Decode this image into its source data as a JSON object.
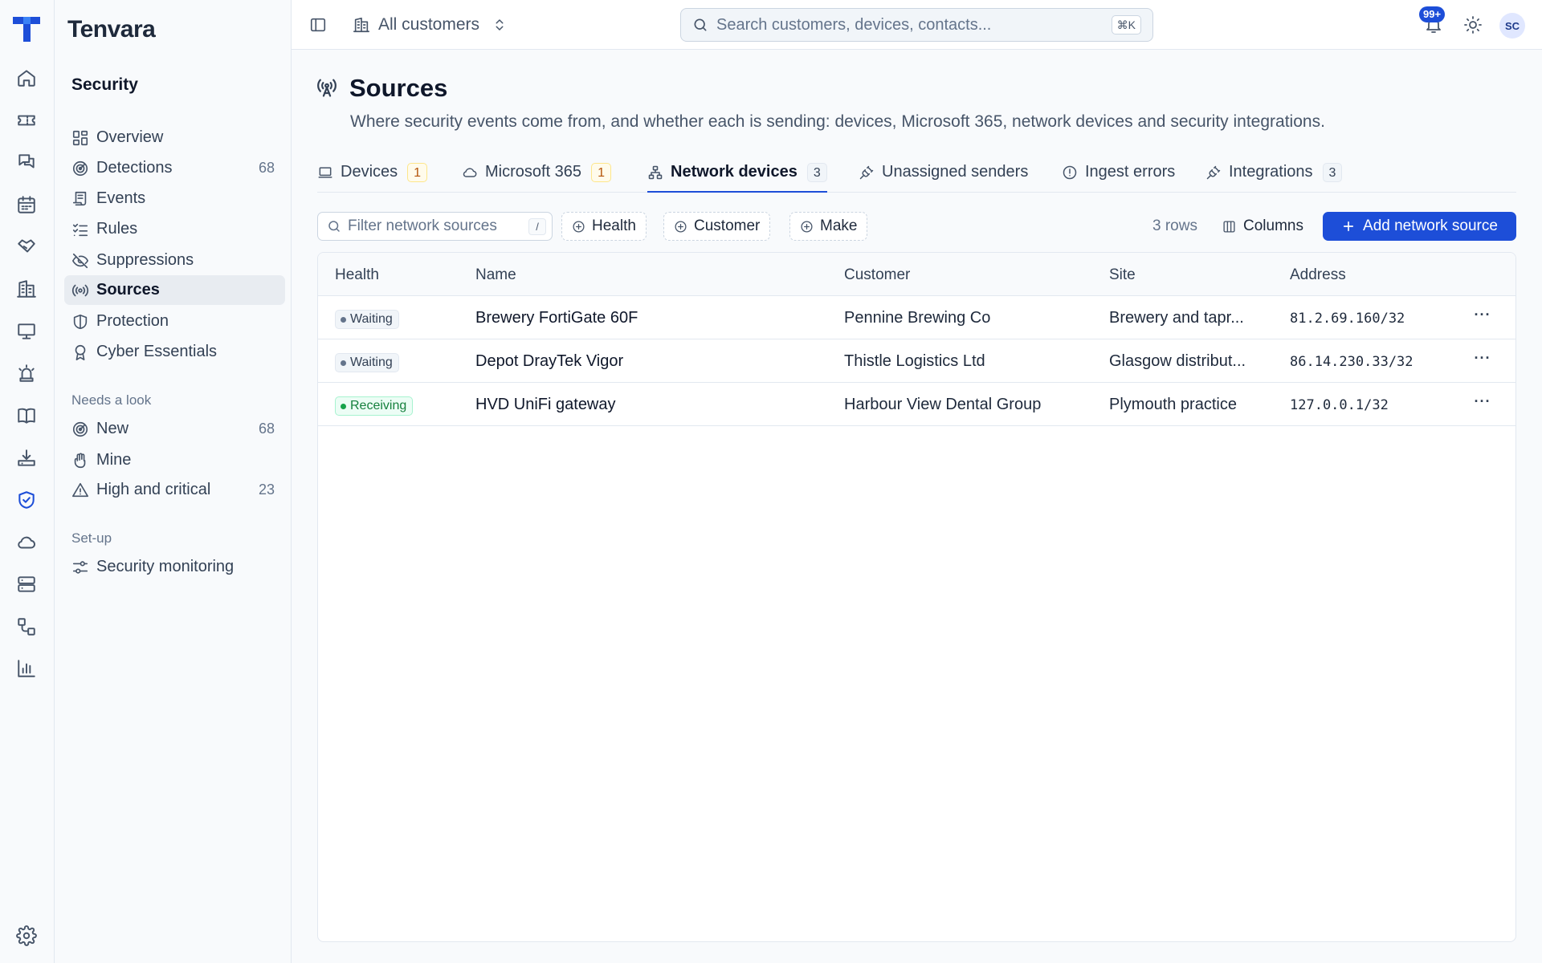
{
  "app": {
    "name": "Tenvara"
  },
  "colors": {
    "accent": "#1d4ed8",
    "waiting": "#64748b",
    "receiving": "#16a34a",
    "warn": "#b45309"
  },
  "sidebar": {
    "title": "Security",
    "items": [
      {
        "label": "Overview",
        "icon": "grid-icon",
        "count": ""
      },
      {
        "label": "Detections",
        "icon": "radar-icon",
        "count": "68"
      },
      {
        "label": "Events",
        "icon": "scroll-icon",
        "count": ""
      },
      {
        "label": "Rules",
        "icon": "checklist-icon",
        "count": ""
      },
      {
        "label": "Suppressions",
        "icon": "eye-off-icon",
        "count": ""
      },
      {
        "label": "Sources",
        "icon": "radio-icon",
        "count": "",
        "active": true
      },
      {
        "label": "Protection",
        "icon": "shield-icon",
        "count": ""
      },
      {
        "label": "Cyber Essentials",
        "icon": "award-icon",
        "count": ""
      }
    ],
    "needs_label": "Needs a look",
    "needs_items": [
      {
        "label": "New",
        "icon": "radar-icon",
        "count": "68"
      },
      {
        "label": "Mine",
        "icon": "hand-icon",
        "count": ""
      },
      {
        "label": "High and critical",
        "icon": "alert-triangle-icon",
        "count": "23"
      }
    ],
    "setup_label": "Set-up",
    "setup_items": [
      {
        "label": "Security monitoring",
        "icon": "sliders-icon",
        "count": ""
      }
    ]
  },
  "topbar": {
    "scope": "All customers",
    "search_placeholder": "Search customers, devices, contacts...",
    "search_shortcut": "⌘K",
    "notifications": "99+",
    "avatar": "SC"
  },
  "page": {
    "title": "Sources",
    "description": "Where security events come from, and whether each is sending: devices, Microsoft 365, network devices and security integrations."
  },
  "tabs": [
    {
      "label": "Devices",
      "count": "1",
      "icon": "laptop-icon"
    },
    {
      "label": "Microsoft 365",
      "count": "1",
      "icon": "cloud-icon"
    },
    {
      "label": "Network devices",
      "count": "3",
      "icon": "network-icon",
      "active": true
    },
    {
      "label": "Unassigned senders",
      "count": "",
      "icon": "plug-icon"
    },
    {
      "label": "Ingest errors",
      "count": "",
      "icon": "alert-circle-icon"
    },
    {
      "label": "Integrations",
      "count": "3",
      "icon": "plug-icon"
    }
  ],
  "toolbar": {
    "filter_placeholder": "Filter network sources",
    "filter_shortcut": "/",
    "chips": [
      "Health",
      "Customer",
      "Make"
    ],
    "rows_count": "3 rows",
    "columns_label": "Columns",
    "add_label": "Add network source"
  },
  "table": {
    "columns": [
      "Health",
      "Name",
      "Customer",
      "Site",
      "Address"
    ],
    "rows": [
      {
        "health": "Waiting",
        "name": "Brewery FortiGate 60F",
        "customer": "Pennine Brewing Co",
        "site": "Brewery and tapr...",
        "address": "81.2.69.160/32"
      },
      {
        "health": "Waiting",
        "name": "Depot DrayTek Vigor",
        "customer": "Thistle Logistics Ltd",
        "site": "Glasgow distribut...",
        "address": "86.14.230.33/32"
      },
      {
        "health": "Receiving",
        "name": "HVD UniFi gateway",
        "customer": "Harbour View Dental Group",
        "site": "Plymouth practice",
        "address": "127.0.0.1/32"
      }
    ]
  }
}
